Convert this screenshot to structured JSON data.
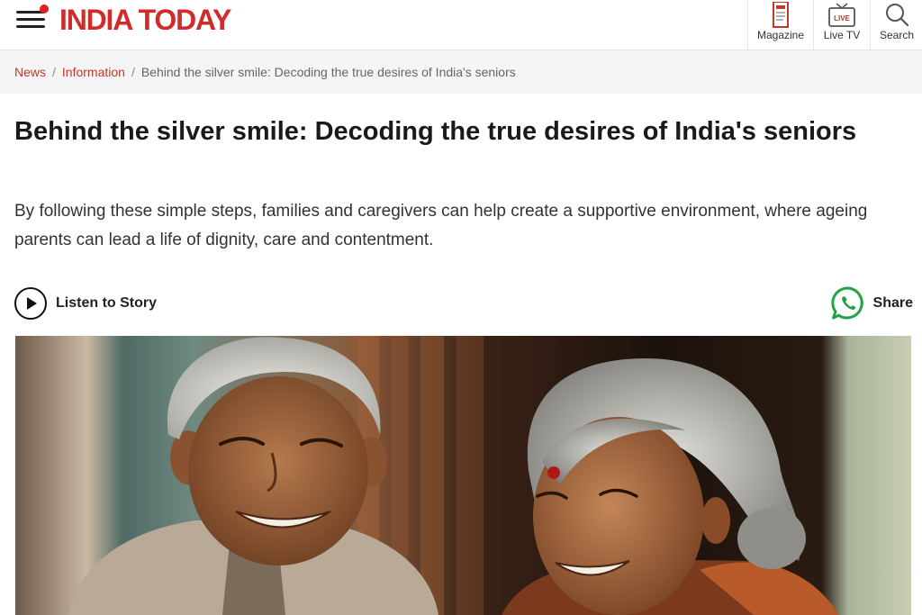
{
  "header": {
    "logo_text": "INDIA TODAY",
    "items": [
      {
        "label": "Magazine",
        "icon": "magazine-icon"
      },
      {
        "label": "Live TV",
        "icon": "live-tv-icon",
        "badge": "LIVE"
      },
      {
        "label": "Search",
        "icon": "search-icon"
      }
    ]
  },
  "breadcrumb": {
    "items": [
      "News",
      "Information"
    ],
    "current": "Behind the silver smile: Decoding the true desires of India's seniors",
    "separator": "/"
  },
  "article": {
    "title": "Behind the silver smile: Decoding the true desires of India's seniors",
    "summary": "By following these simple steps, families and caregivers can help create a supportive environment, where ageing parents can lead a life of dignity, care and contentment.",
    "listen_label": "Listen to Story",
    "share_label": "Share"
  },
  "colors": {
    "brand_red": "#d22b2b",
    "link_red": "#c0392b",
    "whatsapp_green": "#25a244"
  }
}
